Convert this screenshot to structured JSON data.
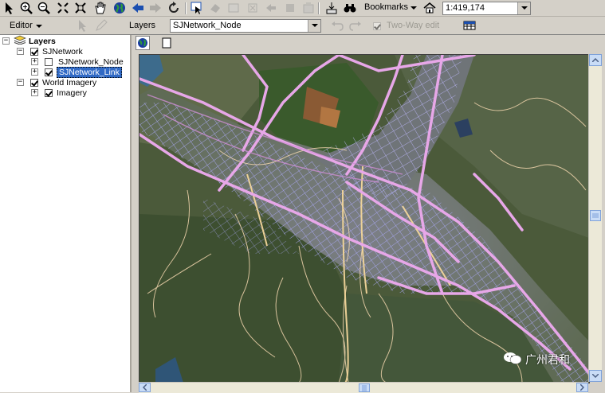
{
  "toolbar": {
    "bookmarks_label": "Bookmarks",
    "scale_value": "1:419,174",
    "icons": [
      "select-arrow-icon",
      "zoom-in-icon",
      "zoom-out-icon",
      "fixed-zoom-in-icon",
      "fixed-zoom-out-icon",
      "pan-hand-icon",
      "full-extent-globe-icon",
      "back-arrow-icon",
      "forward-arrow-icon",
      "refresh-icon",
      "identify-icon",
      "find-icon",
      "measure-icon",
      "hyperlink-icon",
      "html-popup-icon",
      "time-slider-icon",
      "add-data-icon",
      "binoculars-icon",
      "home-icon"
    ]
  },
  "editor_toolbar": {
    "editor_label": "Editor",
    "layers_label": "Layers",
    "layer_value": "SJNetwork_Node",
    "two_way_label": "Two-Way edit"
  },
  "toc": {
    "root_label": "Layers",
    "group1": {
      "label": "SJNetwork",
      "checked": true
    },
    "layer_node": {
      "label": "SJNetwork_Node",
      "checked": false
    },
    "layer_link": {
      "label": "SJNetwork_Link",
      "checked": true
    },
    "group2": {
      "label": "World Imagery",
      "checked": true
    },
    "layer_imagery": {
      "label": "Imagery",
      "checked": true
    }
  },
  "map": {
    "watermark": "广州君和",
    "road_colors": {
      "highway": "#e7a7e8",
      "arterial": "#a9a8f2",
      "minor": "#f2d6ae"
    }
  }
}
